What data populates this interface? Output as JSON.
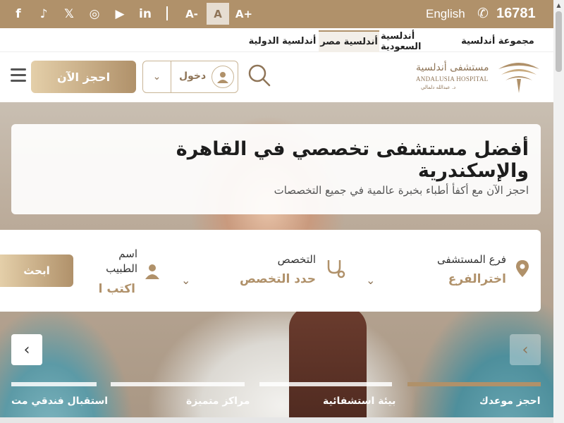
{
  "topbar": {
    "social": [
      {
        "icon": "facebook-icon",
        "glyph": "f"
      },
      {
        "icon": "tiktok-icon",
        "glyph": "♪"
      },
      {
        "icon": "x-icon",
        "glyph": "𝕏"
      },
      {
        "icon": "instagram-icon",
        "glyph": "◎"
      },
      {
        "icon": "youtube-icon",
        "glyph": "▶"
      },
      {
        "icon": "linkedin-icon",
        "glyph": "in"
      }
    ],
    "font_minus": "A-",
    "font_normal": "A",
    "font_plus": "A+",
    "language": "English",
    "hotline": "16781",
    "colors": {
      "bar": "#b0916a"
    }
  },
  "group_tabs": [
    {
      "label": "مجموعة أندلسية"
    },
    {
      "label": "أندلسية السعودية"
    },
    {
      "label": "أندلسية مصر",
      "active": true
    },
    {
      "label": "أندلسية الدولية"
    }
  ],
  "header": {
    "logo_ar": "مستشفى أندلسية",
    "logo_en": "ANDALUSIA HOSPITAL",
    "logo_sub": "د. عبدالله دلمالي",
    "login_label": "دخول",
    "book_label": "احجز الآن"
  },
  "hero": {
    "headline": "أفضل مستشفى تخصصي في القاهرة والإسكندرية",
    "subline": "احجز الآن مع أكفأ أطباء بخبرة عالمية في جميع التخصصات"
  },
  "search": {
    "branch_label": "فرع المستشفى",
    "branch_value": "اخترالفرع",
    "specialty_label": "التخصص",
    "specialty_value": "حدد التخصص",
    "doctor_label_1": "اسم",
    "doctor_label_2": "الطبيب",
    "doctor_placeholder": "اكتب ا",
    "button": "ابحث"
  },
  "slides": [
    {
      "label": "احجز موعدك",
      "active": true
    },
    {
      "label": "بيئة استشفائية"
    },
    {
      "label": "مراكز متميزة"
    },
    {
      "label": "استقبال فندقي مت"
    }
  ]
}
